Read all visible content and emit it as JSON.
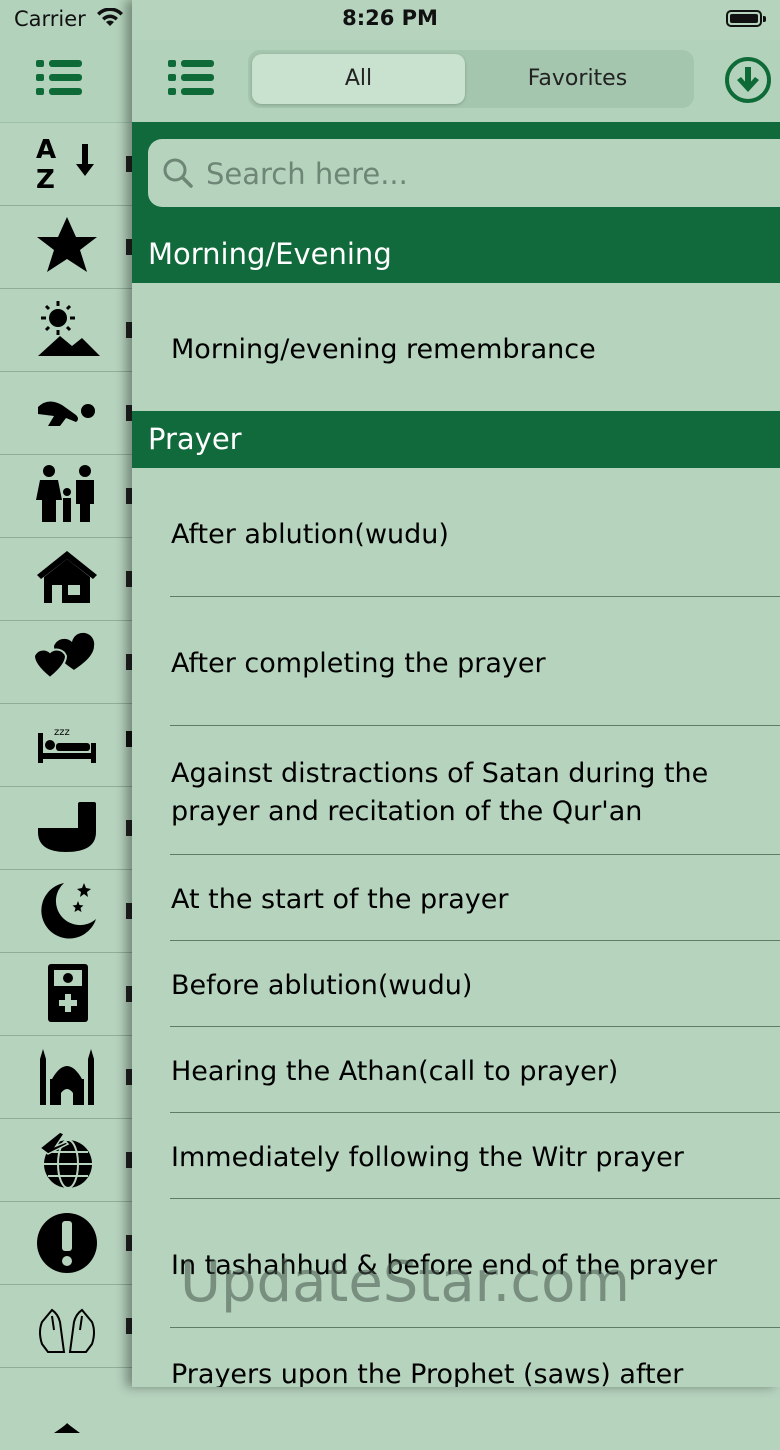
{
  "status_bar": {
    "carrier": "Carrier",
    "time": "8:26 PM"
  },
  "segmented_control": {
    "all_label": "All",
    "favorites_label": "Favorites",
    "selected": "All"
  },
  "search": {
    "placeholder": "Search here..."
  },
  "sections": [
    {
      "title": "Morning/Evening",
      "items": [
        "Morning/evening remembrance"
      ]
    },
    {
      "title": "Prayer",
      "items": [
        "After ablution(wudu)",
        "After completing the prayer",
        "Against distractions of Satan during the prayer and recitation of the Qur'an",
        "At the start of the prayer",
        "Before ablution(wudu)",
        "Hearing the Athan(call to prayer)",
        "Immediately following the Witr prayer",
        "In tashahhud & before end of the prayer",
        "Prayers upon the Prophet (saws) after"
      ]
    }
  ],
  "sidebar_icons": [
    "az-sort-icon",
    "star-icon",
    "sun-landscape-icon",
    "prostrating-person-icon",
    "family-icon",
    "house-icon",
    "hearts-icon",
    "bed-icon",
    "toilet-icon",
    "moon-stars-icon",
    "medical-phone-icon",
    "mosque-icon",
    "globe-plane-icon",
    "exclamation-icon",
    "praying-hands-icon"
  ],
  "watermark": "UpdateStar.com",
  "colors": {
    "accent": "#106a3b",
    "background": "#b6d3be",
    "icon_green": "#0e6b38"
  }
}
